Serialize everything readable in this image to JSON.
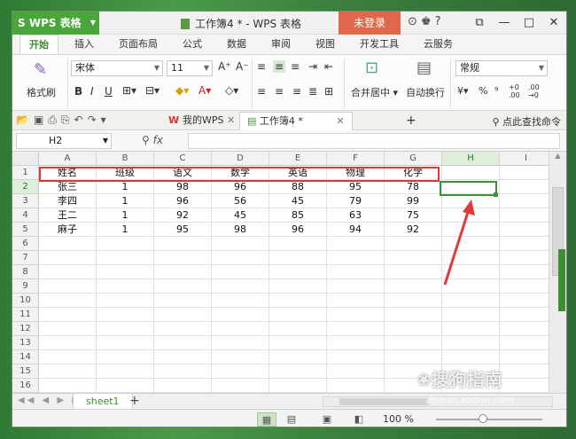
{
  "app": {
    "name": "WPS 表格",
    "doc_title": "工作簿4 * - WPS 表格",
    "login_label": "未登录"
  },
  "tabs": [
    "开始",
    "插入",
    "页面布局",
    "公式",
    "数据",
    "审阅",
    "视图",
    "开发工具",
    "云服务"
  ],
  "ribbon": {
    "format_painter": "格式刷",
    "font_name": "宋体",
    "font_size": "11",
    "merge_center": "合并居中",
    "wrap_text": "自动换行",
    "number_format": "常规",
    "icons": [
      "format-painter",
      "bold",
      "italic",
      "underline",
      "border",
      "fill-color",
      "font-color",
      "align-top",
      "align-center",
      "align-bottom",
      "align-left",
      "align-middle",
      "align-right",
      "merge-center",
      "wrap-text",
      "currency",
      "percent",
      "thousands",
      "increase-decimal",
      "decrease-decimal"
    ]
  },
  "quickbar": {
    "tab_mywps": "我的WPS",
    "tab_doc": "工作簿4 *",
    "search": "点此查找命令"
  },
  "formula_bar": {
    "name_box": "H2",
    "fx_label": "fx",
    "value": ""
  },
  "columns": [
    "A",
    "B",
    "C",
    "D",
    "E",
    "F",
    "G",
    "H",
    "I"
  ],
  "rows": [
    "1",
    "2",
    "3",
    "4",
    "5",
    "6",
    "7",
    "8",
    "9",
    "10",
    "11",
    "12",
    "13",
    "14",
    "15",
    "16"
  ],
  "table": {
    "header": [
      "姓名",
      "班级",
      "语文",
      "数学",
      "英语",
      "物理",
      "化学"
    ],
    "rows": [
      [
        "张三",
        "1",
        "98",
        "96",
        "88",
        "95",
        "78"
      ],
      [
        "李四",
        "1",
        "96",
        "56",
        "45",
        "79",
        "99"
      ],
      [
        "王二",
        "1",
        "92",
        "45",
        "85",
        "63",
        "75"
      ],
      [
        "麻子",
        "1",
        "95",
        "98",
        "96",
        "94",
        "92"
      ]
    ]
  },
  "sheet": {
    "tab_label": "sheet1",
    "add_label": "+"
  },
  "status": {
    "zoom": "100 %"
  },
  "watermark": {
    "text": "搜狗指南",
    "url": "zhinan.sogou.com"
  },
  "colors": {
    "accent": "#4aa53a",
    "login": "#e0674b",
    "highlight_box": "#d43a3a",
    "selection": "#3d8f3b"
  }
}
